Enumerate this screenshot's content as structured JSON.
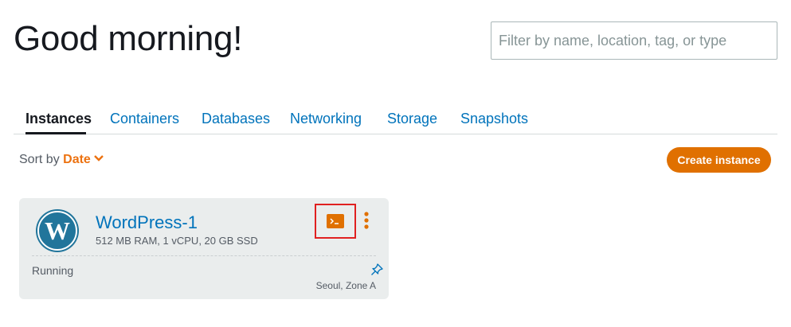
{
  "header": {
    "greeting": "Good morning!",
    "search_placeholder": "Filter by name, location, tag, or type"
  },
  "tabs": [
    {
      "label": "Instances",
      "active": true
    },
    {
      "label": "Containers",
      "active": false
    },
    {
      "label": "Databases",
      "active": false
    },
    {
      "label": "Networking",
      "active": false
    },
    {
      "label": "Storage",
      "active": false
    },
    {
      "label": "Snapshots",
      "active": false
    }
  ],
  "toolbar": {
    "sort_label": "Sort by",
    "sort_value": "Date",
    "create_label": "Create instance"
  },
  "instance": {
    "name": "WordPress-1",
    "specs": "512 MB RAM, 1 vCPU, 20 GB SSD",
    "status": "Running",
    "location": "Seoul, Zone A",
    "icon": "wordpress-icon"
  },
  "colors": {
    "accent": "#ec7211",
    "link": "#0073bb",
    "button": "#e07000",
    "highlight": "#e02020",
    "card_bg": "#eaeded"
  }
}
